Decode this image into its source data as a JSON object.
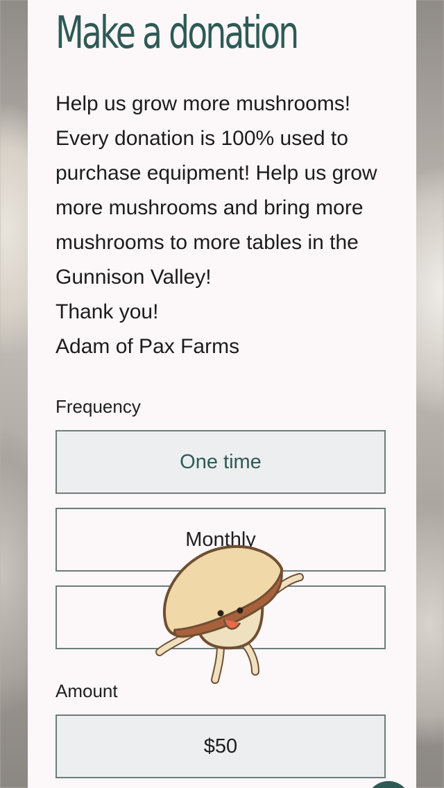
{
  "page": {
    "title": "Make a donation",
    "description": [
      "Help us grow more mushrooms! Every donation is 100% used to purchase equipment! Help us grow more mushrooms and bring more mushrooms to more tables in the Gunnison Valley!",
      "Thank you!",
      "Adam of Pax Farms"
    ]
  },
  "frequency": {
    "label": "Frequency",
    "options": [
      "One time",
      "Monthly",
      ""
    ],
    "selected": "One time"
  },
  "amount": {
    "label": "Amount",
    "selected_value": "$50"
  },
  "colors": {
    "accent": "#2e5a55",
    "panel": "#fcf7f8",
    "selected_fill": "#eceef0"
  },
  "icons": {
    "mascot": "mushroom-mascot-icon",
    "floating_button": "floating-action-button"
  }
}
